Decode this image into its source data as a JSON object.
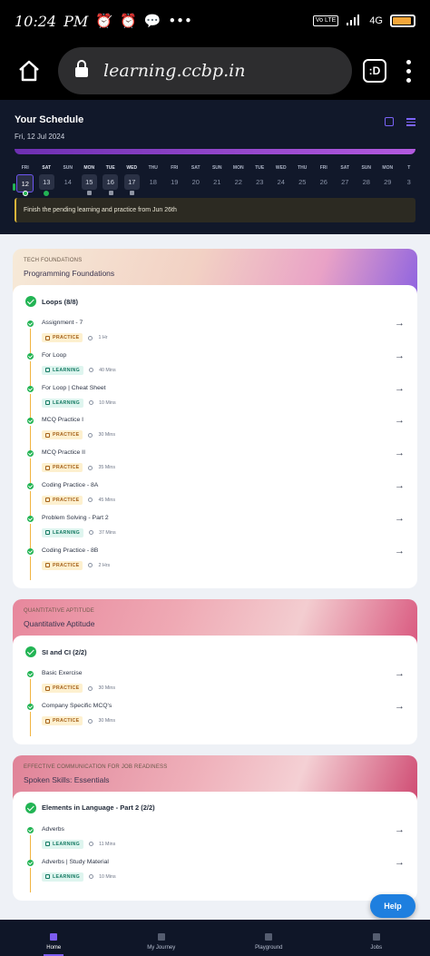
{
  "status_bar": {
    "time": "10:24",
    "ampm": "PM",
    "icons": [
      "alarm-off-icon",
      "alarm-icon",
      "message-icon",
      "more-icon"
    ],
    "right_icons": [
      "volte-icon",
      "signal-icon",
      "battery-icon"
    ],
    "network": "4G",
    "lte": "Vo LTE",
    "battery_level": 0.85
  },
  "browser": {
    "url": "learning.ccbp.in",
    "ext_label": ":D"
  },
  "schedule": {
    "title": "Your Schedule",
    "date": "Fri, 12 Jul 2024",
    "days": [
      {
        "dn": "FRI",
        "num": "12",
        "state": "active",
        "mark": "check"
      },
      {
        "dn": "SAT",
        "num": "13",
        "state": "past",
        "mark": "green"
      },
      {
        "dn": "SUN",
        "num": "14",
        "state": "future",
        "mark": ""
      },
      {
        "dn": "MON",
        "num": "15",
        "state": "past",
        "mark": "grey"
      },
      {
        "dn": "TUE",
        "num": "16",
        "state": "past",
        "mark": "grey"
      },
      {
        "dn": "WED",
        "num": "17",
        "state": "past",
        "mark": "grey"
      },
      {
        "dn": "THU",
        "num": "18",
        "state": "future",
        "mark": ""
      },
      {
        "dn": "FRI",
        "num": "19",
        "state": "future",
        "mark": ""
      },
      {
        "dn": "SAT",
        "num": "20",
        "state": "future",
        "mark": ""
      },
      {
        "dn": "SUN",
        "num": "21",
        "state": "future",
        "mark": ""
      },
      {
        "dn": "MON",
        "num": "22",
        "state": "future",
        "mark": ""
      },
      {
        "dn": "TUE",
        "num": "23",
        "state": "future",
        "mark": ""
      },
      {
        "dn": "WED",
        "num": "24",
        "state": "future",
        "mark": ""
      },
      {
        "dn": "THU",
        "num": "25",
        "state": "future",
        "mark": ""
      },
      {
        "dn": "FRI",
        "num": "26",
        "state": "future",
        "mark": ""
      },
      {
        "dn": "SAT",
        "num": "27",
        "state": "future",
        "mark": ""
      },
      {
        "dn": "SUN",
        "num": "28",
        "state": "future",
        "mark": ""
      },
      {
        "dn": "MON",
        "num": "29",
        "state": "future",
        "mark": ""
      },
      {
        "dn": "T",
        "num": "3",
        "state": "future",
        "mark": ""
      }
    ],
    "alert": "Finish the pending learning and practice from Jun 26th"
  },
  "cards": [
    {
      "kicker": "TECH FOUNDATIONS",
      "title": "Programming Foundations",
      "section": "Loops (8/8)",
      "head_class": "head-1",
      "items": [
        {
          "name": "Assignment - 7",
          "type": "PRACTICE",
          "kind": "practice",
          "duration": "1 Hr"
        },
        {
          "name": "For Loop",
          "type": "LEARNING",
          "kind": "learning",
          "duration": "40 Mins"
        },
        {
          "name": "For Loop | Cheat Sheet",
          "type": "LEARNING",
          "kind": "learning",
          "duration": "10 Mins"
        },
        {
          "name": "MCQ Practice I",
          "type": "PRACTICE",
          "kind": "practice",
          "duration": "30 Mins"
        },
        {
          "name": "MCQ Practice II",
          "type": "PRACTICE",
          "kind": "practice",
          "duration": "35 Mins"
        },
        {
          "name": "Coding Practice - 8A",
          "type": "PRACTICE",
          "kind": "practice",
          "duration": "45 Mins"
        },
        {
          "name": "Problem Solving - Part 2",
          "type": "LEARNING",
          "kind": "learning",
          "duration": "37 Mins"
        },
        {
          "name": "Coding Practice - 8B",
          "type": "PRACTICE",
          "kind": "practice",
          "duration": "2 Hrs"
        }
      ]
    },
    {
      "kicker": "QUANTITATIVE APTITUDE",
      "title": "Quantitative Aptitude",
      "section": "SI and CI (2/2)",
      "head_class": "head-2",
      "items": [
        {
          "name": "Basic Exercise",
          "type": "PRACTICE",
          "kind": "practice",
          "duration": "30 Mins"
        },
        {
          "name": "Company Specific MCQ's",
          "type": "PRACTICE",
          "kind": "practice",
          "duration": "30 Mins"
        }
      ]
    },
    {
      "kicker": "EFFECTIVE COMMUNICATION FOR JOB READINESS",
      "title": "Spoken Skills: Essentials",
      "section": "Elements in Language - Part 2 (2/2)",
      "head_class": "head-3",
      "items": [
        {
          "name": "Adverbs",
          "type": "LEARNING",
          "kind": "learning",
          "duration": "11 Mins"
        },
        {
          "name": "Adverbs | Study Material",
          "type": "LEARNING",
          "kind": "learning",
          "duration": "10 Mins"
        }
      ]
    }
  ],
  "help_label": "Help",
  "nav": [
    {
      "label": "Home",
      "icon": "home-icon",
      "active": true
    },
    {
      "label": "My Journey",
      "icon": "journey-icon",
      "active": false
    },
    {
      "label": "Playground",
      "icon": "terminal-icon",
      "active": false
    },
    {
      "label": "Jobs",
      "icon": "briefcase-icon",
      "active": false
    }
  ]
}
